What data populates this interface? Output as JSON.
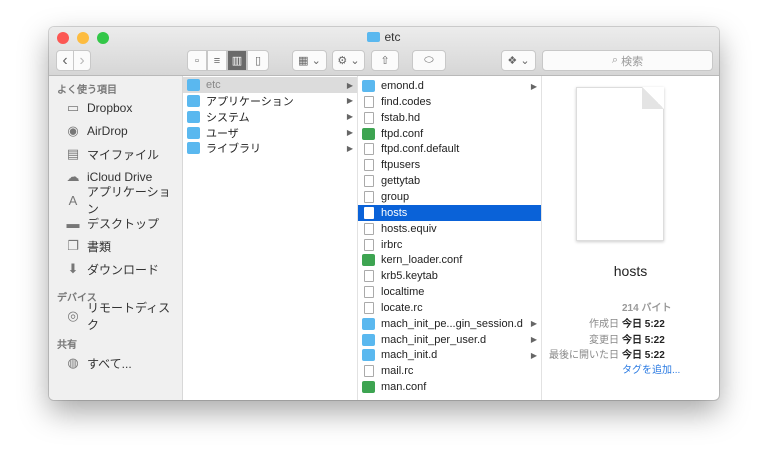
{
  "window": {
    "title": "etc"
  },
  "toolbar": {
    "search_placeholder": "検索",
    "back": "‹",
    "forward": "›"
  },
  "sidebar": {
    "favorites_header": "よく使う項目",
    "favorites": [
      {
        "label": "Dropbox",
        "icon": "folder-icon"
      },
      {
        "label": "AirDrop",
        "icon": "airdrop-icon"
      },
      {
        "label": "マイファイル",
        "icon": "all-files-icon"
      },
      {
        "label": "iCloud Drive",
        "icon": "cloud-icon"
      },
      {
        "label": "アプリケーション",
        "icon": "applications-icon"
      },
      {
        "label": "デスクトップ",
        "icon": "desktop-icon"
      },
      {
        "label": "書類",
        "icon": "documents-icon"
      },
      {
        "label": "ダウンロード",
        "icon": "download-icon"
      }
    ],
    "devices_header": "デバイス",
    "devices": [
      {
        "label": "リモートディスク",
        "icon": "disc-icon"
      }
    ],
    "shared_header": "共有",
    "shared": [
      {
        "label": "すべて...",
        "icon": "network-icon"
      }
    ]
  },
  "column1": [
    {
      "label": "etc",
      "type": "f",
      "sel": "grey"
    },
    {
      "label": "アプリケーション",
      "type": "f"
    },
    {
      "label": "システム",
      "type": "f"
    },
    {
      "label": "ユーザ",
      "type": "f"
    },
    {
      "label": "ライブラリ",
      "type": "f"
    }
  ],
  "column2": [
    {
      "label": "emond.d",
      "type": "f",
      "arrow": true
    },
    {
      "label": "find.codes",
      "type": "d"
    },
    {
      "label": "fstab.hd",
      "type": "d"
    },
    {
      "label": "ftpd.conf",
      "type": "g"
    },
    {
      "label": "ftpd.conf.default",
      "type": "d"
    },
    {
      "label": "ftpusers",
      "type": "d"
    },
    {
      "label": "gettytab",
      "type": "d"
    },
    {
      "label": "group",
      "type": "d"
    },
    {
      "label": "hosts",
      "type": "d",
      "sel": "hl"
    },
    {
      "label": "hosts.equiv",
      "type": "d"
    },
    {
      "label": "irbrc",
      "type": "d"
    },
    {
      "label": "kern_loader.conf",
      "type": "g"
    },
    {
      "label": "krb5.keytab",
      "type": "d"
    },
    {
      "label": "localtime",
      "type": "d"
    },
    {
      "label": "locate.rc",
      "type": "d"
    },
    {
      "label": "mach_init_pe...gin_session.d",
      "type": "f",
      "arrow": true
    },
    {
      "label": "mach_init_per_user.d",
      "type": "f",
      "arrow": true
    },
    {
      "label": "mach_init.d",
      "type": "f",
      "arrow": true
    },
    {
      "label": "mail.rc",
      "type": "d"
    },
    {
      "label": "man.conf",
      "type": "g"
    }
  ],
  "preview": {
    "name": "hosts",
    "size": "214 バイト",
    "created_label": "作成日",
    "created": "今日 5:22",
    "modified_label": "変更日",
    "modified": "今日 5:22",
    "opened_label": "最後に開いた日",
    "opened": "今日 5:22",
    "add_tags": "タグを追加..."
  }
}
